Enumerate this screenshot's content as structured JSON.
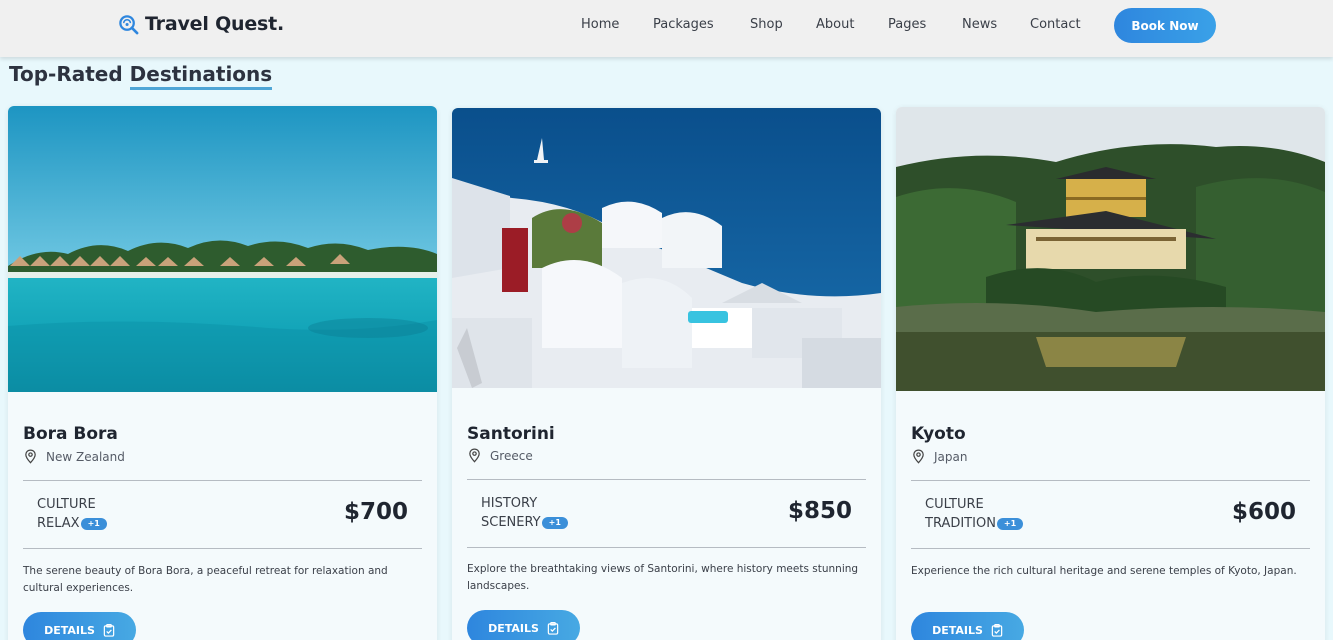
{
  "nav": {
    "brand": "Travel Quest.",
    "links": [
      "Home",
      "Packages",
      "Shop",
      "About",
      "Pages",
      "News",
      "Contact"
    ],
    "cta": "Book Now"
  },
  "section": {
    "title_part1": "Top-Rated",
    "title_part2": "Destinations"
  },
  "cards": [
    {
      "name": "Bora Bora",
      "location": "New Zealand",
      "tags": [
        "CULTURE",
        "RELAX"
      ],
      "extra_tags": "+1",
      "price": "$700",
      "description": "The serene beauty of Bora Bora, a peaceful retreat for relaxation and cultural experiences.",
      "button": "DETAILS",
      "image": "bora-bora-lagoon-photo"
    },
    {
      "name": "Santorini",
      "location": "Greece",
      "tags": [
        "HISTORY",
        "SCENERY"
      ],
      "extra_tags": "+1",
      "price": "$850",
      "description": "Explore the breathtaking views of Santorini, where history meets stunning landscapes.",
      "button": "DETAILS",
      "image": "santorini-white-houses-photo"
    },
    {
      "name": "Kyoto",
      "location": "Japan",
      "tags": [
        "CULTURE",
        "TRADITION"
      ],
      "extra_tags": "+1",
      "price": "$600",
      "description": "Experience the rich cultural heritage and serene temples of Kyoto, Japan.",
      "button": "DETAILS",
      "image": "kyoto-golden-pavilion-photo"
    }
  ],
  "colors": {
    "accent": "#2e86de",
    "page_background": "#e8f8fc",
    "navbar": "#f0f0f0"
  },
  "icons": [
    "search-globe-icon",
    "map-pin-icon",
    "clipboard-check-icon"
  ]
}
